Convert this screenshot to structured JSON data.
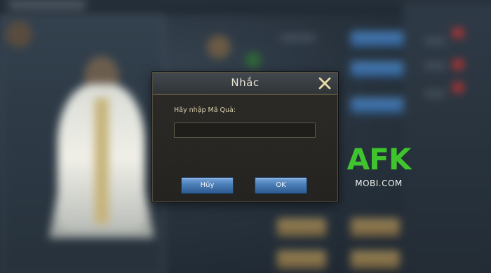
{
  "dialog": {
    "title": "Nhắc",
    "prompt_label": "Hãy nhập Mã Quà:",
    "code_value": "",
    "cancel_label": "Hủy",
    "ok_label": "OK",
    "close_icon": "close-x-icon"
  },
  "watermark": {
    "brand": "AFK",
    "sub": "MOBI.COM"
  },
  "colors": {
    "dialog_bg": "#24221f",
    "button_blue": "#4a7db6",
    "gold_accent": "#b9a160",
    "watermark_green": "#3fc42e"
  }
}
